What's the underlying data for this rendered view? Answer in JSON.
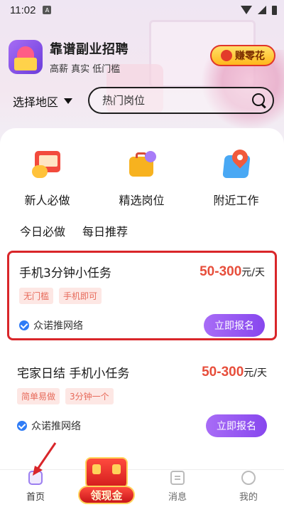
{
  "status_bar": {
    "time": "11:02",
    "sim_label": "A"
  },
  "app": {
    "title": "靠谱副业招聘",
    "subtitle": "高薪 真实 低门槛",
    "earn_button": "赚零花"
  },
  "filters": {
    "region_label": "选择地区",
    "search_placeholder": "热门岗位"
  },
  "categories": [
    {
      "label": "新人必做",
      "icon": "red-envelope-icon"
    },
    {
      "label": "精选岗位",
      "icon": "briefcase-icon"
    },
    {
      "label": "附近工作",
      "icon": "map-pin-icon"
    }
  ],
  "tabs": [
    {
      "label": "今日必做",
      "active": true
    },
    {
      "label": "每日推荐",
      "active": false
    }
  ],
  "jobs": [
    {
      "title": "手机3分钟小任务",
      "salary": "50-300",
      "unit": "元/天",
      "tags": [
        "无门槛",
        "手机即可"
      ],
      "company": "众诺推网络",
      "apply_label": "立即报名",
      "highlighted": true
    },
    {
      "title": "宅家日结 手机小任务",
      "salary": "50-300",
      "unit": "元/天",
      "tags": [
        "简单易做",
        "3分钟一个"
      ],
      "company": "众诺推网络",
      "apply_label": "立即报名",
      "highlighted": false
    }
  ],
  "tabbar": {
    "home": "首页",
    "cash": "领现金",
    "messages": "消息",
    "me": "我的"
  },
  "colors": {
    "accent": "#8c4ef0",
    "salary": "#e74e3b",
    "highlight_border": "#d9262a"
  }
}
